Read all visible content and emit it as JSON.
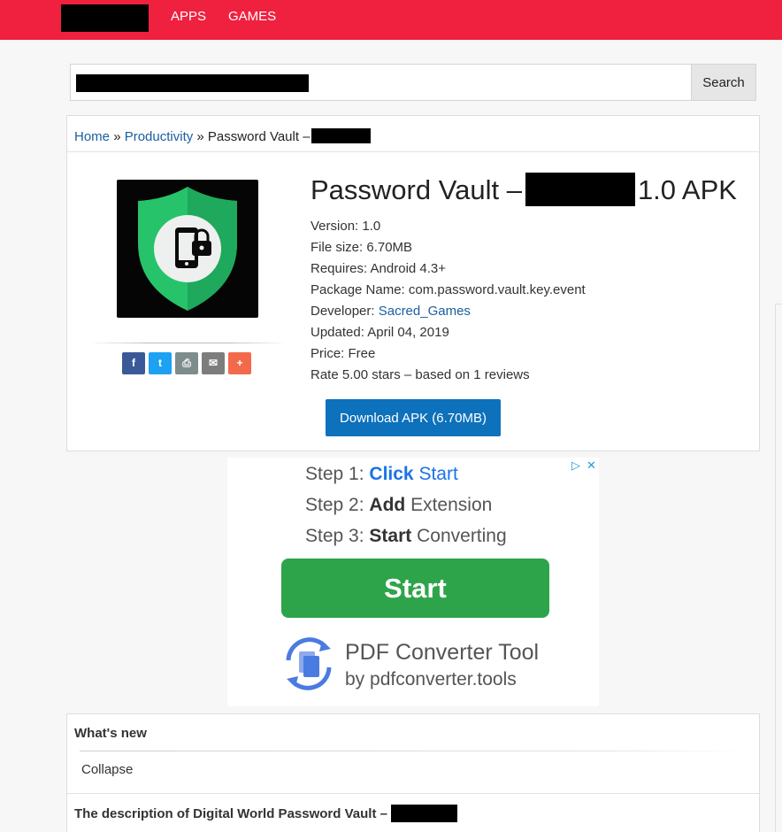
{
  "nav": {
    "items": [
      "APPS",
      "GAMES"
    ]
  },
  "search": {
    "button_label": "Search"
  },
  "breadcrumb": {
    "home": "Home",
    "separator": "»",
    "category": "Productivity",
    "current": "Password Vault –"
  },
  "app": {
    "title_prefix": "Password Vault –",
    "title_suffix": "1.0 APK",
    "icon": "shield-lock-phone-icon",
    "version_label": "Version:",
    "version": "1.0",
    "file_size_label": "File size:",
    "file_size": "6.70MB",
    "requires_label": "Requires:",
    "requires": "Android 4.3+",
    "package_label": "Package Name:",
    "package": "com.password.vault.key.event",
    "developer_label": "Developer:",
    "developer": "Sacred_Games",
    "updated_label": "Updated:",
    "updated": "April 04, 2019",
    "price_label": "Price:",
    "price": "Free",
    "rating_text": "Rate 5.00 stars – based on 1 reviews",
    "download_label": "Download APK (6.70MB)"
  },
  "share": [
    {
      "icon": "facebook-icon",
      "glyph": "f",
      "color": "#3b5998"
    },
    {
      "icon": "twitter-icon",
      "glyph": "t",
      "color": "#1da1f2"
    },
    {
      "icon": "print-icon",
      "glyph": "⎙",
      "color": "#7f8c8d"
    },
    {
      "icon": "email-icon",
      "glyph": "✉",
      "color": "#7d7d7d"
    },
    {
      "icon": "plus-icon",
      "glyph": "+",
      "color": "#f26a4b"
    }
  ],
  "ad": {
    "step1_prefix": "Step 1:",
    "step1_bold": "Click",
    "step1_rest": "Start",
    "step2_prefix": "Step 2:",
    "step2_bold": "Add",
    "step2_rest": "Extension",
    "step3_prefix": "Step 3:",
    "step3_bold": "Start",
    "step3_rest": "Converting",
    "cta": "Start",
    "brand": "PDF Converter Tool",
    "by_line": "by pdfconverter.tools",
    "adchoices_glyph": "▷",
    "close_glyph": "✕"
  },
  "whats_new": {
    "heading": "What's new",
    "collapse": "Collapse"
  },
  "description": {
    "heading": "The description of Digital World Password Vault –"
  },
  "colors": {
    "brand_red": "#f0203f",
    "link_blue": "#1a5fa0",
    "download_blue": "#0d71bb",
    "ad_green": "#2ea44a"
  }
}
